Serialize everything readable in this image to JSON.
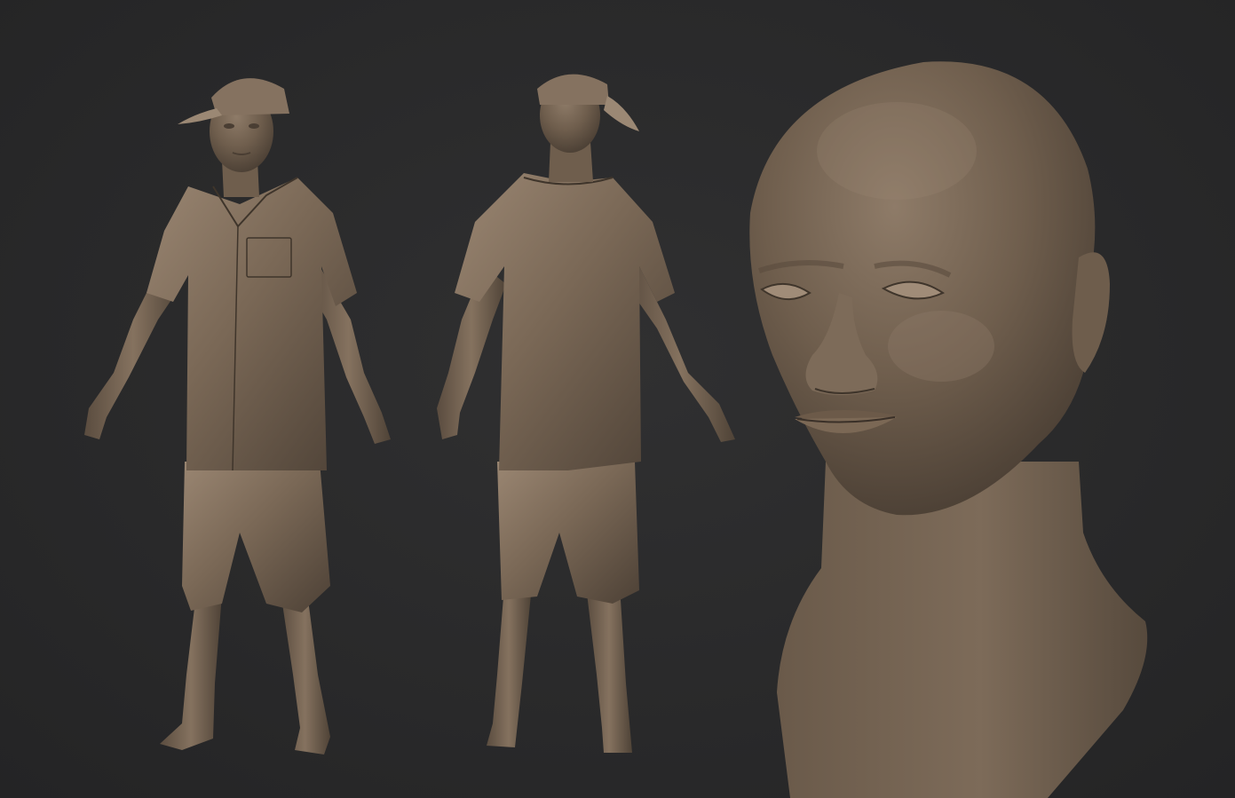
{
  "scene": {
    "background_color": "#2a2a2b",
    "material_color": "#7a6a58",
    "material_shadow_color": "#4a3e33",
    "material_highlight_color": "#a08d78",
    "views": [
      {
        "id": "front",
        "subject": "full-body-front"
      },
      {
        "id": "back",
        "subject": "full-body-back"
      },
      {
        "id": "head",
        "subject": "head-bust-closeup"
      }
    ]
  }
}
